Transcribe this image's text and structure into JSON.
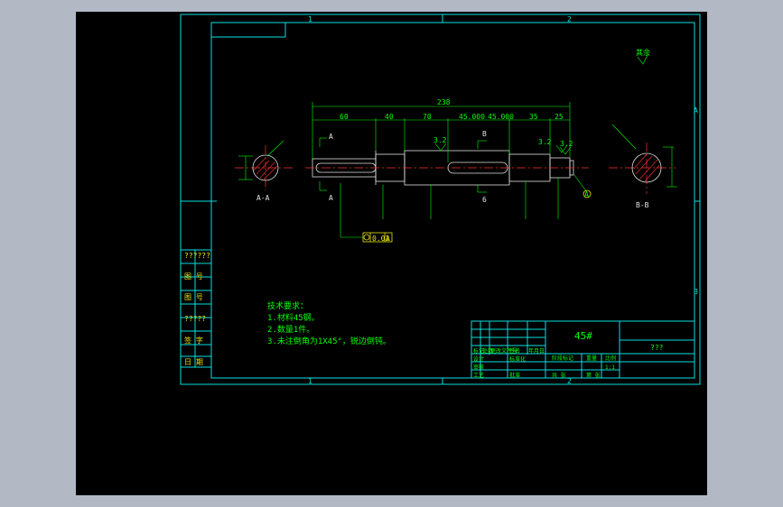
{
  "colors": {
    "frame": "#00e0e0",
    "text": "#00ff00",
    "center": "#ff3030",
    "accent": "#e8e800"
  },
  "zones": {
    "top_1": "1",
    "top_2": "2",
    "right_a": "A",
    "right_b": "B",
    "bottom_1": "1",
    "bottom_2": "2"
  },
  "surface_note": "其余",
  "sections": {
    "a_top": "A",
    "a_bottom": "A",
    "b_top": "B",
    "b_bottom": "6",
    "a_caption": "A-A",
    "b_caption": "B-B"
  },
  "dimensions": {
    "overall": "238",
    "d1": "60",
    "d2": "40",
    "d3": "70",
    "d4": "45.000",
    "d5": "45.000",
    "d6": "35",
    "d7": "25",
    "ra_left": "3.2",
    "ra_mid": "3.2",
    "ra_right": "3.2",
    "datum": "A",
    "tolerance_value": "0.02",
    "tolerance_datum": "A"
  },
  "left_side_cells": [
    "??????",
    "图 号",
    "图 号",
    "?????",
    "签 字",
    "日 期"
  ],
  "requirements": {
    "title": "技术要求：",
    "items": [
      "1.材料45钢。",
      "2.数量1件。",
      "3.未注倒角为1X45°，锐边倒钝。"
    ]
  },
  "title_block": {
    "material": "45#",
    "drawing_name": "???",
    "labels": [
      "标记",
      "处数",
      "更改文件号",
      "签名",
      "年月日",
      "设计",
      "标准化",
      "审核",
      "工艺",
      "批准"
    ],
    "stage_labels": [
      "阶段标记",
      "重量",
      "比例"
    ],
    "scale": "1:1",
    "sheet": "共 张",
    "sheet_of": "第 张"
  }
}
